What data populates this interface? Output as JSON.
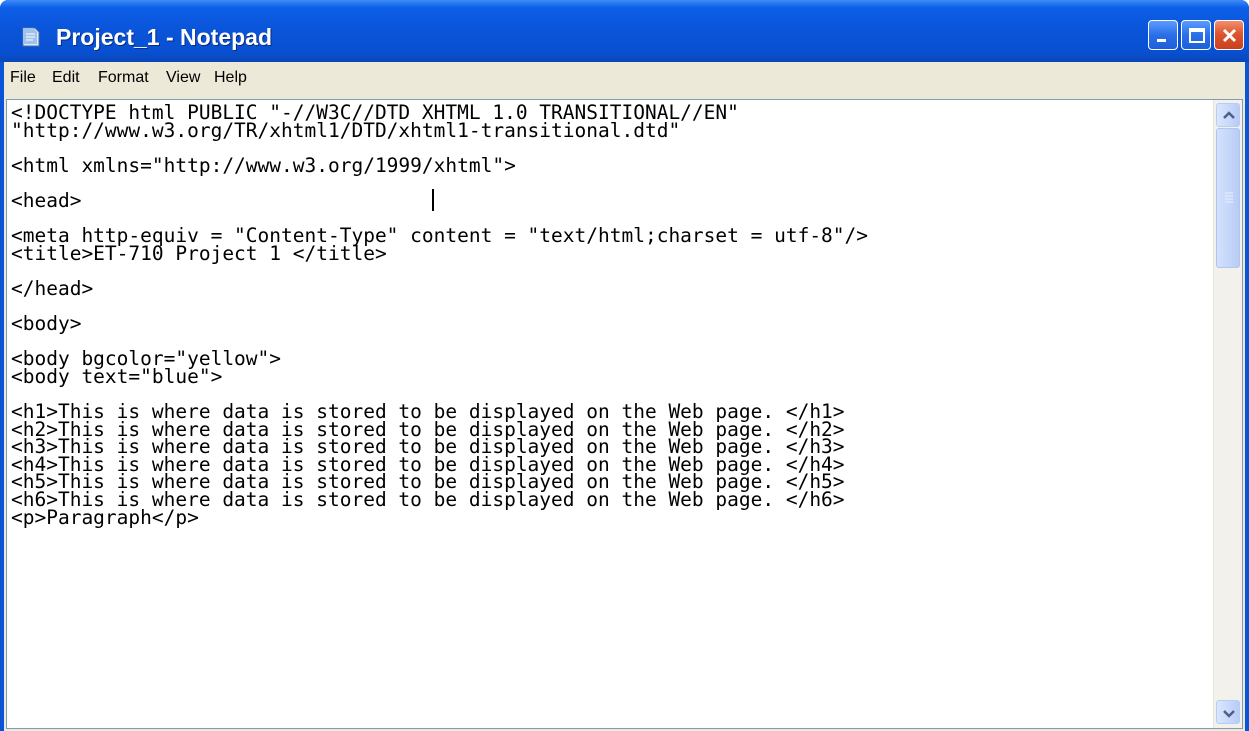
{
  "window": {
    "title": "Project_1 - Notepad",
    "icon": "notepad-icon",
    "controls": [
      "minimize-icon",
      "maximize-icon",
      "close-icon"
    ]
  },
  "menu": {
    "file": "File",
    "edit": "Edit",
    "format": "Format",
    "view": "View",
    "help": "Help"
  },
  "document": {
    "text": "<!DOCTYPE html PUBLIC \"-//W3C//DTD XHTML 1.0 TRANSITIONAL//EN\"\n\"http://www.w3.org/TR/xhtml1/DTD/xhtml1-transitional.dtd\"\n\n<html xmlns=\"http://www.w3.org/1999/xhtml\">\n\n<head>\n\n<meta http-equiv = \"Content-Type\" content = \"text/html;charset = utf-8\"/>\n<title>ET-710 Project 1 </title>\n\n</head>\n\n<body>\n\n<body bgcolor=\"yellow\">\n<body text=\"blue\">\n\n<h1>This is where data is stored to be displayed on the Web page. </h1>\n<h2>This is where data is stored to be displayed on the Web page. </h2>\n<h3>This is where data is stored to be displayed on the Web page. </h3>\n<h4>This is where data is stored to be displayed on the Web page. </h4>\n<h5>This is where data is stored to be displayed on the Web page. </h5>\n<h6>This is where data is stored to be displayed on the Web page. </h6>\n<p>Paragraph</p>"
  },
  "colors": {
    "titlebar": "#0a54d8",
    "close_button": "#e0552e",
    "client_background": "#ece9d8"
  }
}
